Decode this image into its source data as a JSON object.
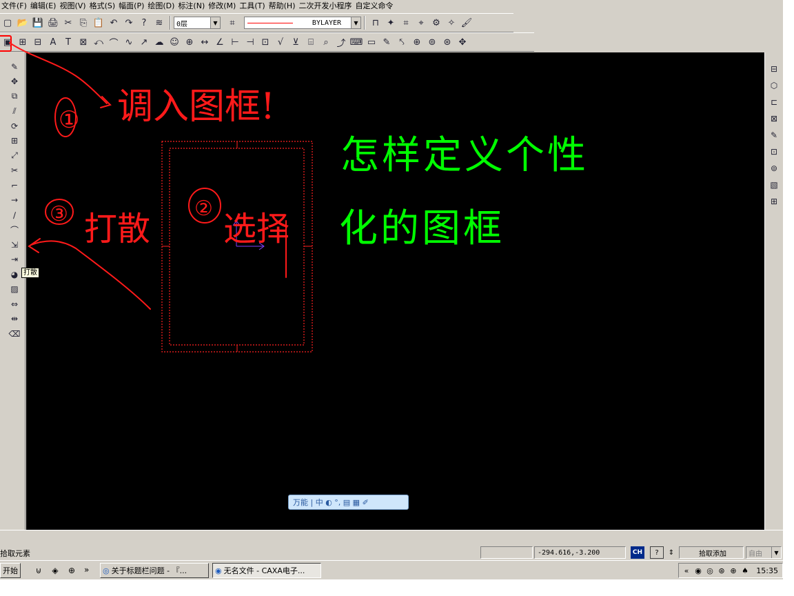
{
  "menu": [
    "文件(F)",
    "编辑(E)",
    "视图(V)",
    "格式(S)",
    "幅面(P)",
    "绘图(D)",
    "标注(N)",
    "修改(M)",
    "工具(T)",
    "帮助(H)",
    "二次开发小程序",
    "自定义命令"
  ],
  "toolbar1": {
    "buttons_a": [
      "new-file-icon",
      "open-folder-icon",
      "save-icon",
      "print-icon",
      "cut-icon",
      "copy-icon",
      "paste-icon",
      "undo-icon",
      "redo-icon",
      "help-icon",
      "layer-icon"
    ],
    "layer_value": "0层",
    "linetype_value": "BYLAYER",
    "buttons_b": [
      "snap-icon",
      "point-icon",
      "display-icon",
      "filter-icon",
      "magic-icon",
      "star-icon",
      "paint-icon"
    ],
    "glyphs_a": [
      "▢",
      "📂",
      "💾",
      "🖨",
      "✂",
      "⎘",
      "📋",
      "↶",
      "↷",
      "?",
      "≋"
    ],
    "glyphs_b": [
      "⊓",
      "✦",
      "⌗",
      "⌖",
      "⚙",
      "✧",
      "🖌"
    ]
  },
  "toolbar2": {
    "icons": [
      "call-frame-icon",
      "frame-icon",
      "title-block-icon",
      "text-icon",
      "table-icon",
      "text-edit-icon",
      "line-icon",
      "arc-icon",
      "curve-icon",
      "arrow-icon",
      "cloud-icon",
      "face-icon",
      "grid-icon",
      "dimension-icon",
      "angle-dim-icon",
      "ordinate-icon",
      "weld-icon",
      "tolerance-icon",
      "roughness-icon",
      "symbol-icon",
      "mark-icon",
      "balloon-icon",
      "leader-icon",
      "query-icon",
      "measure-icon",
      "pencil-icon",
      "zoom-prev-icon",
      "zoom-icon",
      "zoom-window-icon",
      "zoom-all-icon",
      "pan-icon"
    ],
    "glyphs": [
      "▣",
      "⊞",
      "⊟",
      "A",
      "T",
      "⊠",
      "⤺",
      "⌒",
      "∿",
      "↗",
      "☁",
      "☺",
      "⊕",
      "↔",
      "∠",
      "⊢",
      "⊣",
      "⊡",
      "√",
      "⊻",
      "⌸",
      "⌕",
      "⤴",
      "⌨",
      "▭",
      "✎",
      "⤣",
      "⊕",
      "⊚",
      "⊛",
      "✥"
    ]
  },
  "left_toolbar": {
    "icons": [
      "brush-icon",
      "move-icon",
      "copy-object-icon",
      "mirror-icon",
      "rotate-icon",
      "array-icon",
      "scale-icon",
      "trim-icon",
      "fillet-icon",
      "extend-icon",
      "break-icon",
      "stretch-icon",
      "explode-icon",
      "align-icon",
      "color-icon",
      "hatch-icon",
      "dim-edit-icon",
      "label-icon",
      "eraser-icon"
    ],
    "glyphs": [
      "✎",
      "✥",
      "⧉",
      "⫽",
      "⟳",
      "⊞",
      "⤢",
      "✂",
      "⌐",
      "→",
      "∕",
      "⌒",
      "⇲",
      "⇥",
      "◕",
      "▨",
      "⇔",
      "⇹",
      "⌫"
    ]
  },
  "right_toolbar": {
    "icons": [
      "layout-icon",
      "cube-icon",
      "view-icon",
      "view-list-icon",
      "edit-view-icon",
      "block-icon",
      "block-edit-icon",
      "library-icon",
      "insert-icon"
    ],
    "glyphs": [
      "⊟",
      "⬡",
      "⊏",
      "⊠",
      "✎",
      "⊡",
      "⊚",
      "▧",
      "⊞"
    ]
  },
  "annotations": {
    "step1": "①",
    "step1_text": "调入图框!",
    "step2": "②",
    "step2_text": "选择",
    "step3": "③",
    "step3_text": "打散"
  },
  "heading": {
    "line1": "怎样定义个性",
    "line2": "化的图框",
    "color": "#00ff00"
  },
  "tooltip": "打散",
  "imebar": "万能 | 中 ◐ °, ▤ ▦ ✐",
  "status": {
    "prompt": "拾取元素",
    "coords": "-294.616,-3.200",
    "mode_badge": "CH",
    "help": "?",
    "pick_mode": "拾取添加",
    "snap_mode": "自由"
  },
  "taskbar": {
    "start_label": "开始",
    "quicklaunch": [
      "ie-icon",
      "media-icon",
      "browser-icon"
    ],
    "quicklaunch_glyphs": [
      "⊍",
      "◈",
      "⊕"
    ],
    "more": "»",
    "tasks": [
      "关于标题栏问题 - 『...",
      "无名文件 - CAXA电子..."
    ],
    "tray_prefix": "«",
    "tray_icons": [
      "net-icon",
      "sound-icon",
      "ime-icon",
      "update-icon",
      "flag-icon"
    ],
    "tray_glyphs": [
      "◉",
      "◎",
      "⊛",
      "⊕",
      "♠"
    ],
    "time": "15:35"
  }
}
